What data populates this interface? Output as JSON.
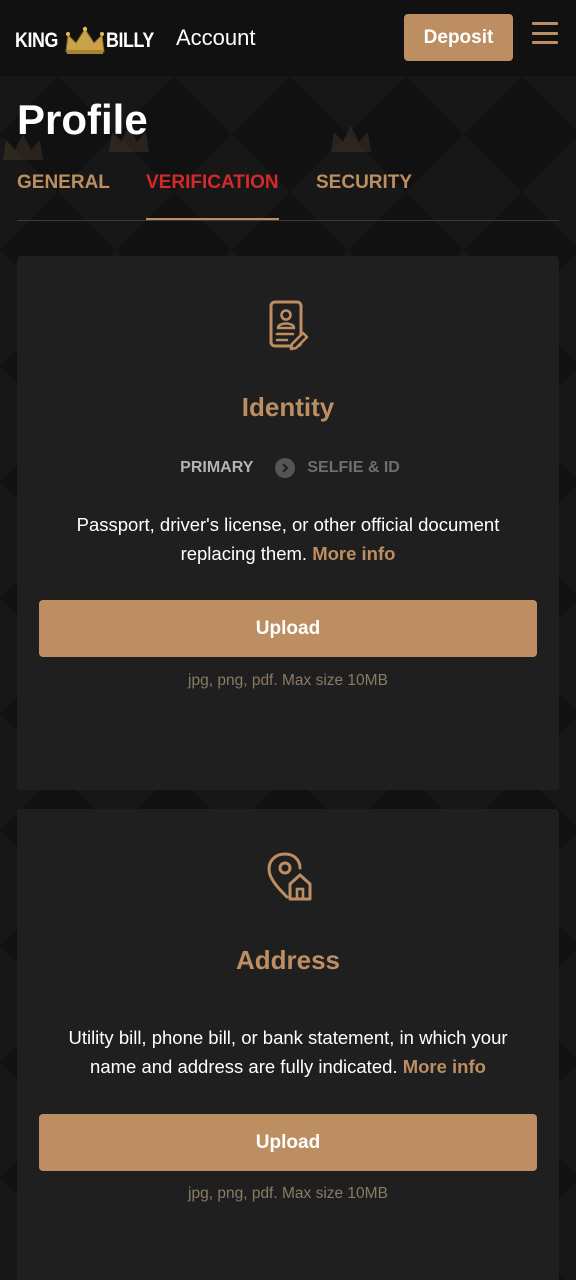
{
  "header": {
    "logo_left": "KING",
    "logo_right": "BILLY",
    "title": "Account",
    "deposit_label": "Deposit"
  },
  "page": {
    "title": "Profile"
  },
  "tabs": [
    {
      "label": "GENERAL",
      "active": false
    },
    {
      "label": "VERIFICATION",
      "active": true
    },
    {
      "label": "SECURITY",
      "active": false
    }
  ],
  "identity": {
    "title": "Identity",
    "step_primary": "PRIMARY",
    "step_secondary": "SELFIE & ID",
    "description": "Passport, driver's license, or other official document replacing them.",
    "more_info": "More info",
    "upload_label": "Upload",
    "hint": "jpg, png, pdf. Max size 10MB"
  },
  "address": {
    "title": "Address",
    "description": "Utility bill, phone bill, or bank statement, in which your name and address are fully indicated.",
    "more_info": "More info",
    "upload_label": "Upload",
    "hint": "jpg, png, pdf. Max size 10MB"
  },
  "colors": {
    "accent": "#bd8e62",
    "active_tab": "#d22a2a",
    "card_bg": "#1f1f1f",
    "page_bg": "#111111"
  },
  "icons": [
    "crown-logo-icon",
    "menu-icon",
    "id-card-icon",
    "chevron-right-icon",
    "location-home-icon"
  ]
}
